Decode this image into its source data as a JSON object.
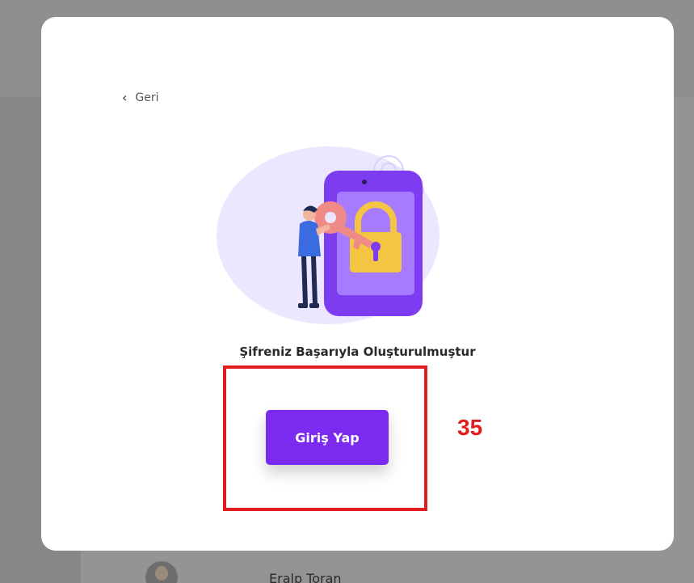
{
  "background": {
    "user_name": "Eralp Toran"
  },
  "modal": {
    "back_label": "Geri",
    "back_icon": "chevron-left-icon",
    "illustration": "phone-lock-key-illustration",
    "success_message": "Şifreniz Başarıyla Oluşturulmuştur",
    "login_button_label": "Giriş Yap",
    "accent_color": "#7a2bef"
  },
  "annotation": {
    "label": "35",
    "color": "#e11d1d"
  }
}
